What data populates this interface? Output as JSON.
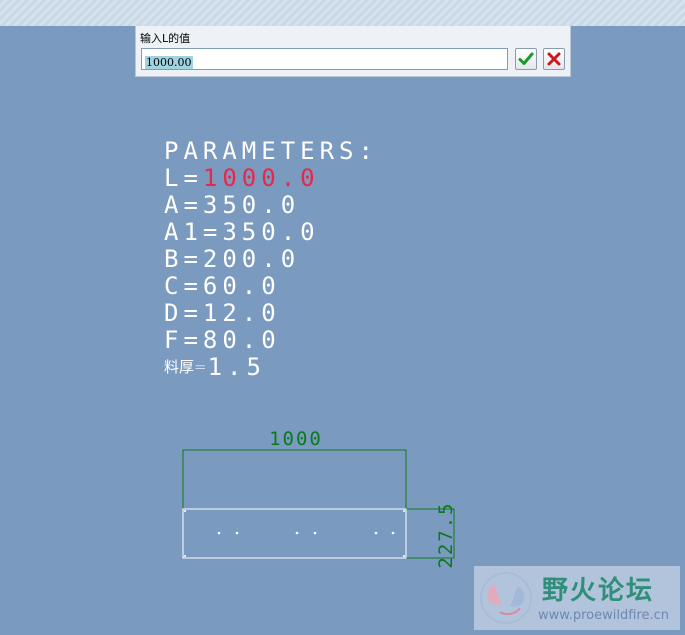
{
  "dialog": {
    "prompt": "输入L的值",
    "input_value": "1000.00",
    "ok_icon": "check-icon",
    "cancel_icon": "x-icon"
  },
  "parameters": {
    "heading": "PARAMETERS:",
    "rows": [
      {
        "name": "L=",
        "value": "1000.0",
        "highlight": true
      },
      {
        "name": "A=",
        "value": "350.0"
      },
      {
        "name": "A1=",
        "value": "350.0"
      },
      {
        "name": "B=",
        "value": "200.0"
      },
      {
        "name": "C=",
        "value": "60.0"
      },
      {
        "name": "D=",
        "value": "12.0"
      },
      {
        "name": "F=",
        "value": "80.0"
      },
      {
        "name": "料厚=",
        "value": "1.5"
      }
    ]
  },
  "drawing": {
    "dim_width": "1000",
    "dim_height": "227.5"
  },
  "watermark": {
    "title": "野火论坛",
    "url": "www.proewildfire.cn"
  },
  "colors": {
    "background": "#7b9abf",
    "dimension": "#0b7a1e",
    "highlight": "#e8274a",
    "geometry": "#ffffff"
  }
}
